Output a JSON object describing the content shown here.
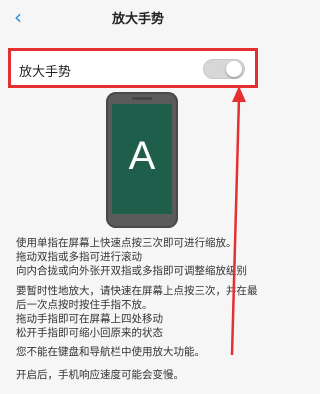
{
  "header": {
    "title": "放大手势",
    "back_icon": "chevron-left-icon"
  },
  "setting": {
    "label": "放大手势",
    "toggle_state": "off"
  },
  "preview": {
    "letter": "A"
  },
  "instructions": {
    "block1": [
      "使用单指在屏幕上快速点按三次即可进行缩放。",
      "拖动双指或多指可进行滚动",
      "向内合拢或向外张开双指或多指即可调整缩放级别"
    ],
    "block2": [
      "要暂时性地放大，请快速在屏幕上点按三次，并在最",
      "后一次点按时按住手指不放。",
      "拖动手指即可在屏幕上四处移动",
      "松开手指即可缩小回原来的状态"
    ],
    "note1": "您不能在键盘和导航栏中使用放大功能。",
    "note2": "开启后，手机响应速度可能会变慢。"
  },
  "colors": {
    "accent": "#2a8cdb",
    "highlight": "#e53030",
    "screen": "#1f5e4b"
  }
}
